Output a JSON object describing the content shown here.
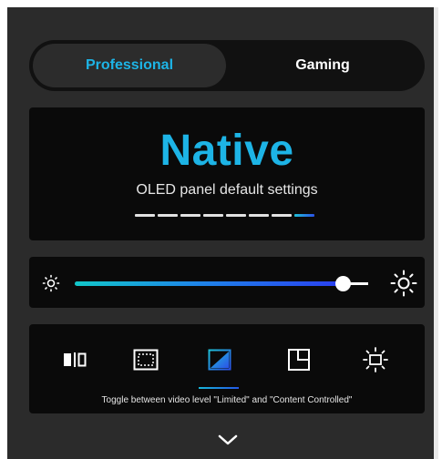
{
  "tabs": {
    "professional_label": "Professional",
    "gaming_label": "Gaming",
    "active": "Professional"
  },
  "mode": {
    "title": "Native",
    "subtitle": "OLED panel default settings",
    "preset_count": 8,
    "selected_preset": 8
  },
  "brightness": {
    "value_fraction": 0.92,
    "min_icon": "sun-small-icon",
    "max_icon": "sun-large-icon"
  },
  "tools": {
    "items": [
      {
        "icon": "split-view-icon",
        "selected": false
      },
      {
        "icon": "frame-border-icon",
        "selected": false
      },
      {
        "icon": "video-level-icon",
        "selected": true
      },
      {
        "icon": "corner-window-icon",
        "selected": false
      },
      {
        "icon": "brightness-adjust-icon",
        "selected": false
      }
    ],
    "caption": "Toggle between video level \"Limited\" and \"Content Controlled\""
  },
  "footer": {
    "expand_icon": "chevron-down-icon"
  },
  "colors": {
    "accent": "#1db4e6",
    "panel": "#0a0a0a",
    "background": "#2b2b2b"
  }
}
